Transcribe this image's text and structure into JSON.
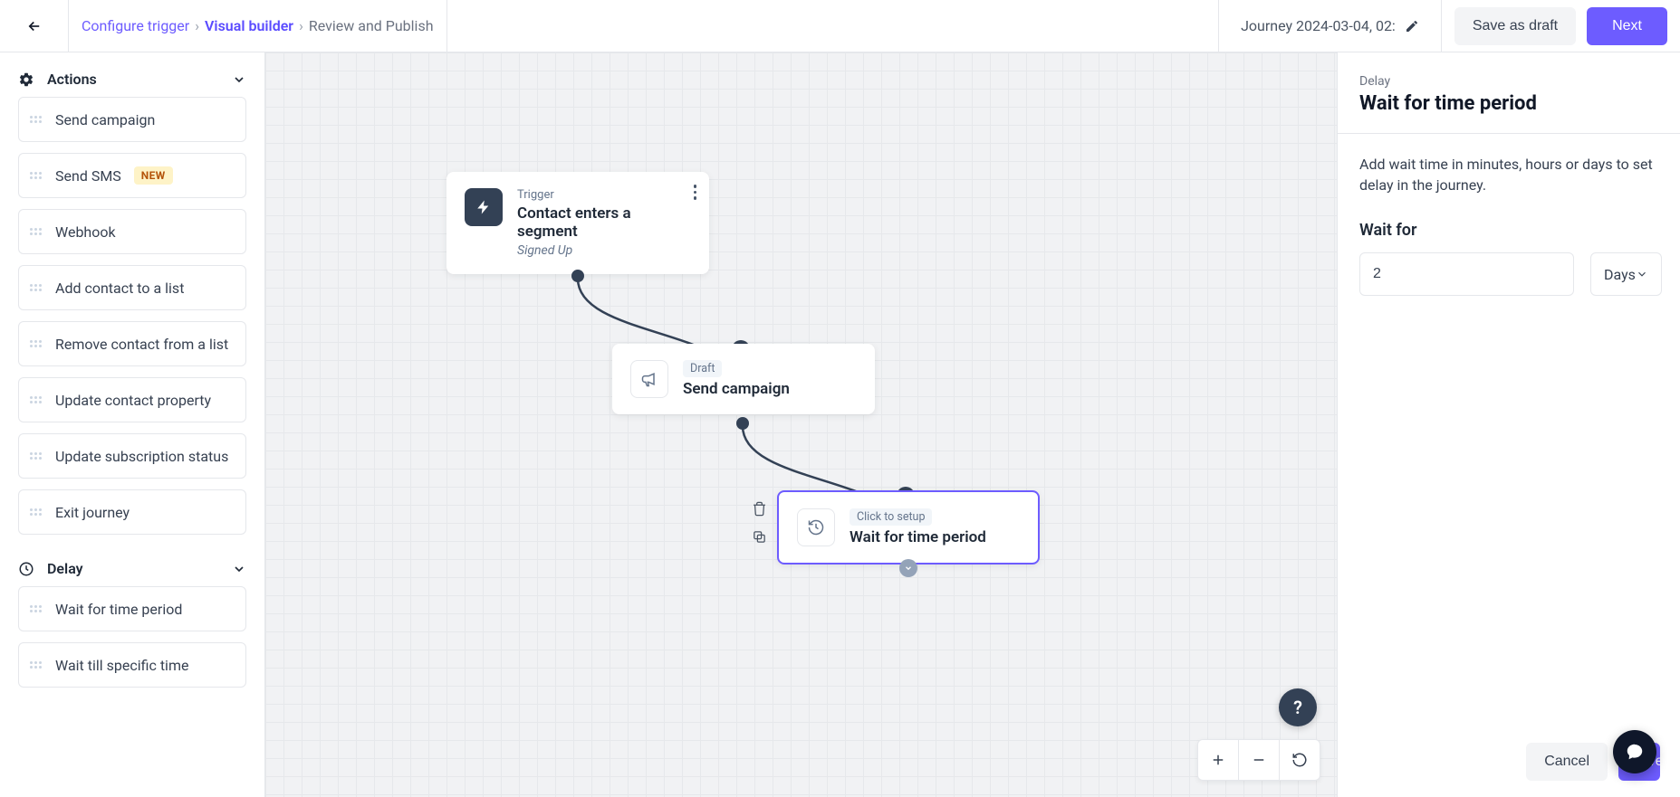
{
  "header": {
    "breadcrumb": {
      "step1": "Configure trigger",
      "step2": "Visual builder",
      "step3": "Review and Publish"
    },
    "journey_title": "Journey 2024-03-04, 02:",
    "save_draft_label": "Save as draft",
    "next_label": "Next"
  },
  "sidebar": {
    "sections": {
      "actions": {
        "title": "Actions",
        "items": [
          {
            "label": "Send campaign",
            "badge": null
          },
          {
            "label": "Send SMS",
            "badge": "NEW"
          },
          {
            "label": "Webhook",
            "badge": null
          },
          {
            "label": "Add contact to a list",
            "badge": null
          },
          {
            "label": "Remove contact from a list",
            "badge": null
          },
          {
            "label": "Update contact property",
            "badge": null
          },
          {
            "label": "Update subscription status",
            "badge": null
          },
          {
            "label": "Exit journey",
            "badge": null
          }
        ]
      },
      "delay": {
        "title": "Delay",
        "items": [
          {
            "label": "Wait for time period"
          },
          {
            "label": "Wait till specific time"
          }
        ]
      }
    }
  },
  "canvas": {
    "nodes": {
      "trigger": {
        "tag": "Trigger",
        "title": "Contact enters a segment",
        "sub": "Signed Up"
      },
      "campaign": {
        "pill": "Draft",
        "title": "Send campaign"
      },
      "wait": {
        "pill": "Click to setup",
        "title": "Wait for time period"
      }
    }
  },
  "right_panel": {
    "eyebrow": "Delay",
    "title": "Wait for time period",
    "description": "Add wait time in minutes, hours or days to set delay in the journey.",
    "field_label": "Wait for",
    "value": "2",
    "unit": "Days",
    "cancel_label": "Cancel",
    "save_label": "Save"
  }
}
